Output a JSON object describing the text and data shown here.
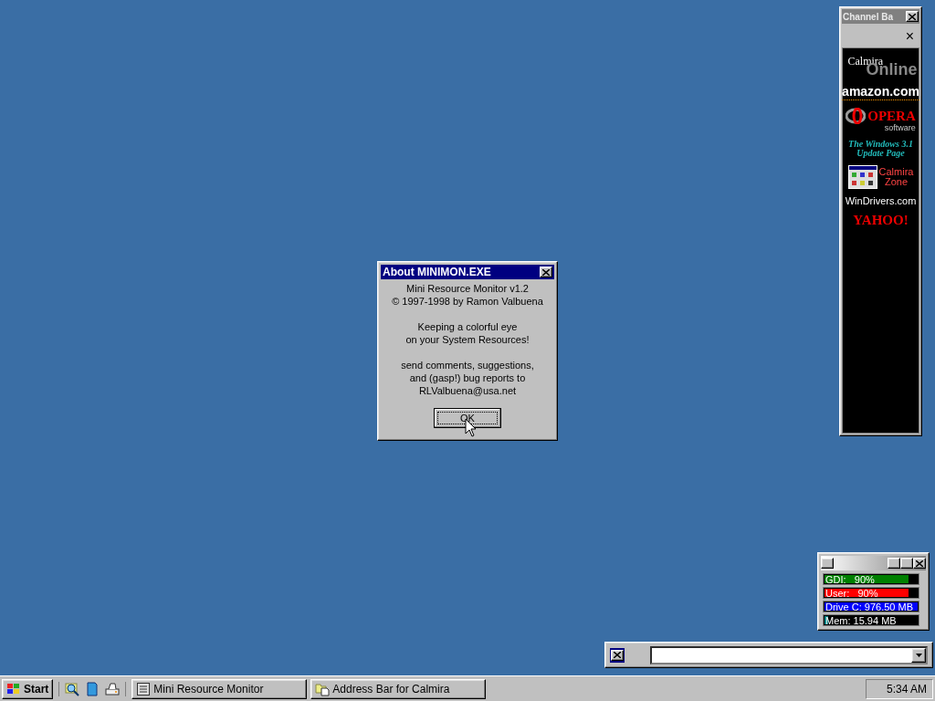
{
  "about_dialog": {
    "title": "About MINIMON.EXE",
    "paragraphs": [
      [
        "Mini Resource Monitor v1.2",
        "© 1997-1998 by Ramon Valbuena"
      ],
      [
        "Keeping a colorful eye",
        "on your System Resources!"
      ],
      [
        "send comments, suggestions,",
        "and (gasp!) bug reports to",
        "RLValbuena@usa.net"
      ]
    ],
    "button": "OK"
  },
  "channel_bar": {
    "title": "Channel Ba",
    "close": "×",
    "channels": [
      {
        "kind": "calmira-online",
        "lines": [
          "Calmira",
          "Online"
        ]
      },
      {
        "kind": "amazon",
        "lines": [
          "amazon.com"
        ]
      },
      {
        "kind": "opera",
        "lines": [
          "OPERA",
          "software"
        ]
      },
      {
        "kind": "win31",
        "lines": [
          "The Windows 3.1",
          "Update Page"
        ]
      },
      {
        "kind": "calmira-zone",
        "lines": [
          "Calmira",
          "Zone"
        ]
      },
      {
        "kind": "windrivers",
        "lines": [
          "WinDrivers.com"
        ]
      },
      {
        "kind": "yahoo",
        "lines": [
          "YAHOO!"
        ]
      }
    ]
  },
  "resource_monitor": {
    "meters": [
      {
        "label": "GDI:   90%",
        "level": 0.9,
        "color": "#008000"
      },
      {
        "label": "User:   90%",
        "level": 0.9,
        "color": "#ff0000"
      },
      {
        "label": "Drive C: 976.50 MB",
        "level": 1,
        "color": "#0000ff"
      },
      {
        "label": "Mem: 15.94 MB",
        "level": 0.04,
        "color": "#008080"
      }
    ]
  },
  "taskbar": {
    "start": "Start",
    "tasks": [
      {
        "label": "Mini Resource Monitor",
        "selected": false
      },
      {
        "label": "Address Bar for Calmira",
        "selected": false
      }
    ],
    "clock": "5:34 AM"
  }
}
